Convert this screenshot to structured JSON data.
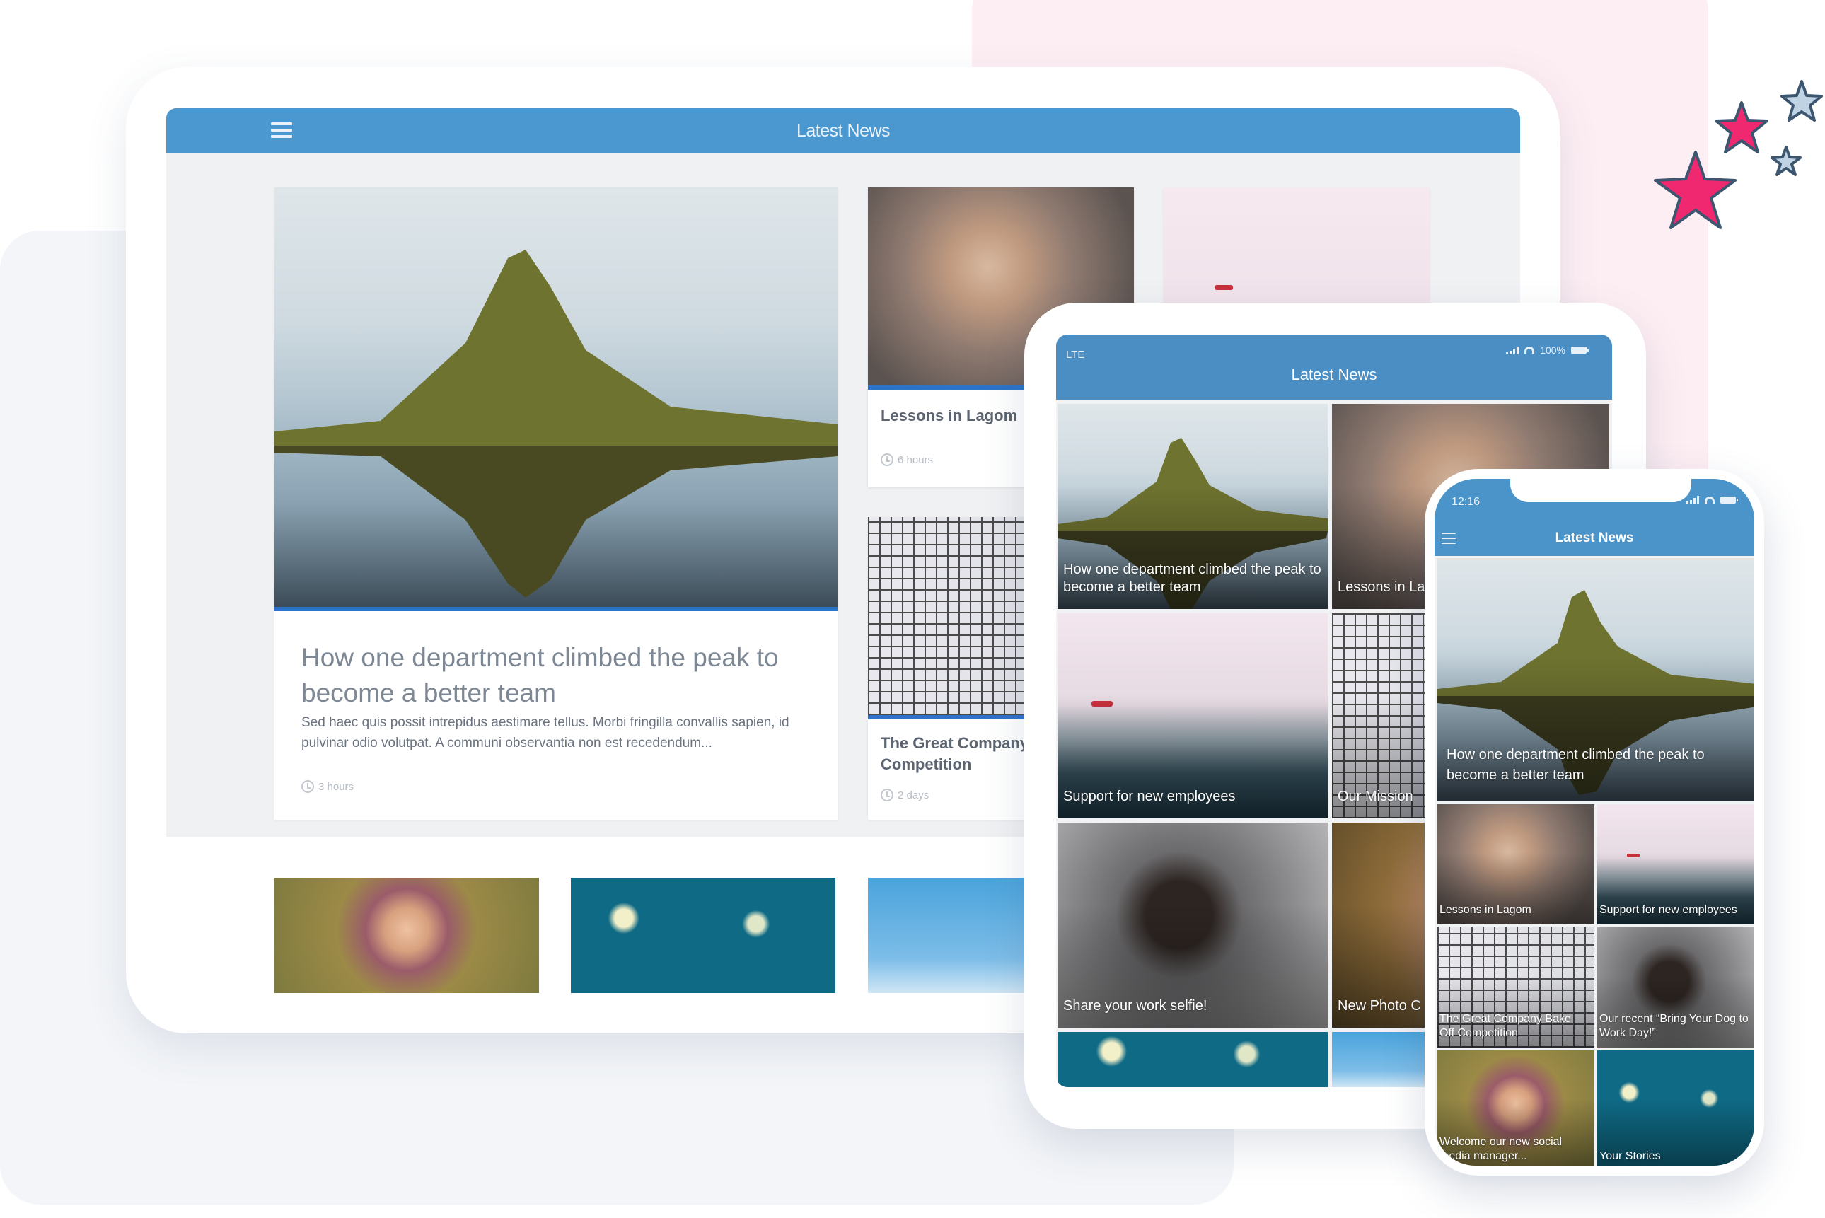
{
  "theme": {
    "header_blue": "#4a98cf",
    "accent_bar": "#2d73c9",
    "star_pink": "#f0286f",
    "star_blue": "#bfd3e4",
    "star_outline": "#3d5670"
  },
  "desktop_tablet": {
    "header": {
      "title": "Latest News",
      "menu_icon": "hamburger-icon"
    },
    "featured": {
      "title": "How one department climbed the peak to become a better team",
      "excerpt": "Sed haec quis possit intrepidus aestimare tellus. Morbi fringilla convallis sapien, id pulvinar odio volutpat. A communi observantia non est recedendum...",
      "time": "3 hours",
      "image": "mountain-reflection"
    },
    "cards": [
      {
        "title": "Lessons in Lagom",
        "time": "6 hours",
        "image": "people-smiling"
      },
      {
        "title": "The Great Company Competition",
        "time": "2 days",
        "image": "baking"
      },
      {
        "title": "",
        "time": "",
        "image": "helicopter-pink-sky"
      }
    ],
    "lower_row": [
      {
        "image": "girl-portrait"
      },
      {
        "image": "confetti"
      },
      {
        "image": "sky"
      }
    ]
  },
  "mid_tablet": {
    "status": {
      "carrier": "LTE",
      "battery": "100%"
    },
    "header": {
      "title": "Latest News"
    },
    "tiles": [
      {
        "caption": "How one department climbed the peak to become a better team",
        "image": "mountain-reflection"
      },
      {
        "caption": "Lessons in Lagom",
        "image": "people-smiling"
      },
      {
        "caption": "Support for new employees",
        "image": "helicopter-sea"
      },
      {
        "caption": "Our Mission",
        "image": "baking"
      },
      {
        "caption": "Share your work selfie!",
        "image": "dogs"
      },
      {
        "caption": "New Photo C",
        "image": "woman-portrait"
      },
      {
        "caption": "",
        "image": "confetti"
      },
      {
        "caption": "",
        "image": "sky"
      }
    ]
  },
  "phone": {
    "status": {
      "time": "12:16"
    },
    "header": {
      "title": "Latest News",
      "menu_icon": "hamburger-icon"
    },
    "hero": {
      "caption": "How one department climbed the peak to become a better team",
      "image": "mountain-reflection"
    },
    "tiles": [
      {
        "caption": "Lessons in Lagom",
        "image": "people-smiling"
      },
      {
        "caption": "Support for new employees",
        "image": "helicopter-sea"
      },
      {
        "caption": "The Great Company Bake Off Competition",
        "image": "baking"
      },
      {
        "caption": "Our recent “Bring Your Dog to Work Day!”",
        "image": "dogs"
      },
      {
        "caption": "Welcome our new social media manager...",
        "image": "girl-portrait"
      },
      {
        "caption": "Your Stories",
        "image": "confetti"
      }
    ]
  }
}
